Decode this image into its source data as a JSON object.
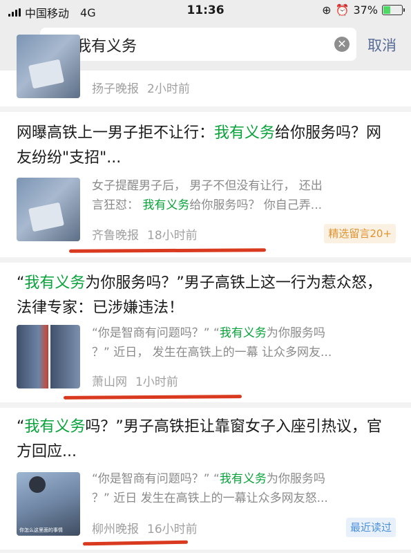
{
  "status_bar": {
    "carrier": "中国移动",
    "network": "4G",
    "time": "11:36",
    "battery": "37%",
    "battery_level": 0.37
  },
  "search": {
    "back_icon": "chevron-left-icon",
    "doc_icon": "document-icon",
    "query": "我有义务",
    "clear_icon": "clear-icon",
    "cancel_label": "取消"
  },
  "colors": {
    "highlight": "#07a33a",
    "link": "#576b95",
    "underline": "#d93a1f"
  },
  "results": [
    {
      "source": "扬子晚报",
      "time": "2小时前"
    },
    {
      "title_pre": "网曝高铁上一男子拒不让行：",
      "title_hl": "我有义务",
      "title_post": "给你服务吗？网友纷纷\"支招\"...",
      "snippet_l1": "女子提醒男子后， 男子不但没有让行， 还出",
      "snippet_l2_pre": "言狂怼： ",
      "snippet_l2_hl": "我有义务",
      "snippet_l2_post": "给你服务吗？ 你自己弄...",
      "source": "齐鲁晚报",
      "time": "18小时前",
      "tag": "精选留言20+"
    },
    {
      "title_pre": "“",
      "title_hl": "我有义务",
      "title_post": "为你服务吗？”男子高铁上这一行为惹众怒，法律专家：已涉嫌违法！",
      "snippet_l1_pre": "“你是智商有问题吗？” “",
      "snippet_l1_hl": "我有义务",
      "snippet_l1_post": "为你服务吗",
      "snippet_l2": "？” 近日， 发生在高铁上的一幕 让众多网友...",
      "source": "萧山网",
      "time": "1小时前"
    },
    {
      "title_pre": "“",
      "title_hl": "我有义务",
      "title_post": "吗？”男子高铁拒让靠窗女子入座引热议，官方回应...",
      "snippet_l1_pre": "“你是智商有问题吗？” “",
      "snippet_l1_hl": "我有义务",
      "snippet_l1_post": "为你服务吗",
      "snippet_l2": "？” 近日 发生在高铁上的一幕让众多网友怒...",
      "source": "柳州晚报",
      "time": "16小时前",
      "tag": "最近读过",
      "thumb_caption": "你怎么这里面的事情"
    }
  ]
}
